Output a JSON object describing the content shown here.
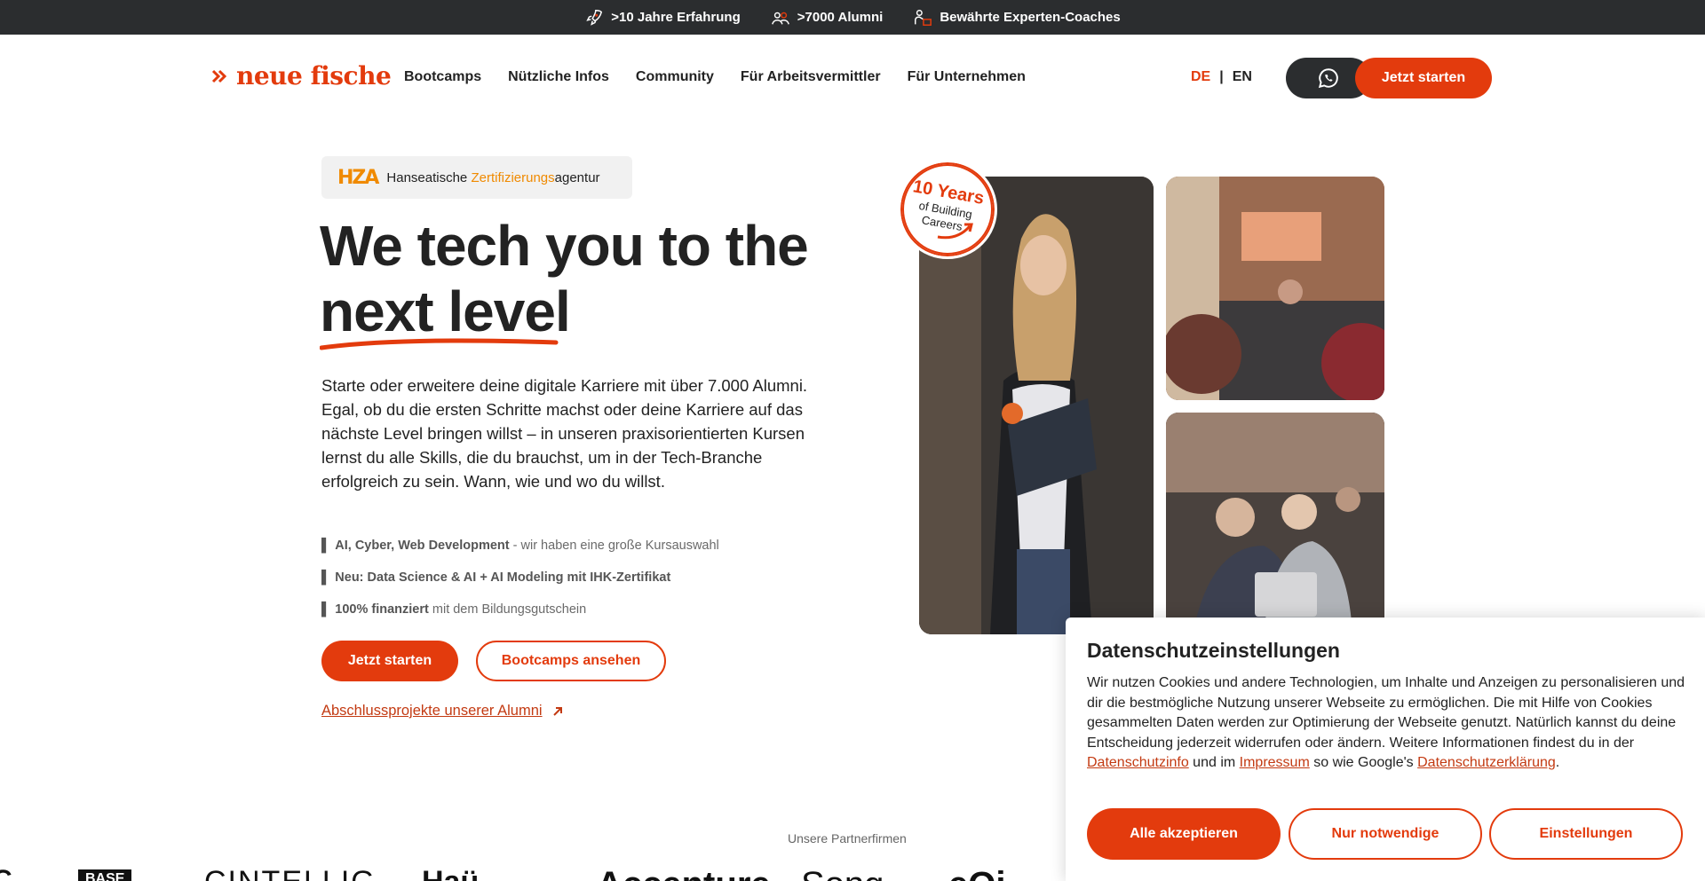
{
  "topbar": {
    "items": [
      {
        "label": ">10 Jahre Erfahrung",
        "icon": "rocket-icon"
      },
      {
        "label": ">7000 Alumni",
        "icon": "people-icon"
      },
      {
        "label": "Bewährte Experten-Coaches",
        "icon": "coach-icon"
      }
    ]
  },
  "nav": {
    "logo_text": "neue fische",
    "links": [
      "Bootcamps",
      "Nützliche Infos",
      "Community",
      "Für Arbeitsvermittler",
      "Für Unternehmen"
    ],
    "lang_active": "DE",
    "lang_separator": "|",
    "lang_other": "EN",
    "whatsapp_icon": "whatsapp-icon",
    "cta_label": "Jetzt starten"
  },
  "badge": {
    "logo_text": "HZA",
    "text_prefix": "Hanseatische ",
    "text_highlight": "Zertifizierungs",
    "text_suffix": "agentur"
  },
  "hero": {
    "title_line1": "We tech you to the",
    "title_line2": "next level",
    "text": "Starte oder erweitere deine digitale Karriere mit über 7.000 Alumni. Egal, ob du die ersten Schritte machst oder deine Karriere auf das nächste Level bringen willst – in unseren praxisorientierten Kursen lernst du alle Skills, die du brauchst, um in der Tech-Branche erfolgreich zu sein. Wann, wie und wo du willst.",
    "bullets": [
      {
        "mark": "▌",
        "bold": "AI, Cyber, Web Development",
        "rest": " - wir haben eine große Kursauswahl"
      },
      {
        "mark": "▌",
        "bold": "Neu: Data Science & AI + AI Modeling mit IHK-Zertifikat",
        "rest": ""
      },
      {
        "mark": "▌",
        "bold": "100% finanziert",
        "rest": " mit dem Bildungsgutschein"
      }
    ],
    "primary_button": "Jetzt starten",
    "secondary_button": "Bootcamps ansehen",
    "alumni_link": "Abschlussprojekte unserer Alumni",
    "alumni_link_icon": "arrow-up-right-icon"
  },
  "stamp": {
    "line1": "10 Years",
    "line2": "of Building",
    "line3": "Careers"
  },
  "partners": {
    "label": "Unsere Partnerfirmen",
    "names": [
      "C",
      "BASE",
      "CINTELLIG",
      "Haü",
      "Accenture",
      "Song",
      "eQi"
    ]
  },
  "cookie": {
    "title": "Datenschutzeinstellungen",
    "text_part1": "Wir nutzen Cookies und andere Technologien, um Inhalte und Anzeigen zu personalisieren und dir die bestmögliche Nutzung unserer Webseite zu ermöglichen. Die mit Hilfe von Cookies gesammelten Daten werden zur Optimierung der Webseite genutzt. Natürlich kannst du deine Entscheidung jederzeit widerrufen oder ändern. Weitere Informationen findest du in der ",
    "link1": "Datenschutzinfo",
    "text_part2": " und im ",
    "link2": "Impressum",
    "text_part3": " so wie Google's ",
    "link3": "Datenschutzerklärung",
    "text_part4": ".",
    "accept": "Alle akzeptieren",
    "necessary": "Nur notwendige",
    "settings": "Einstellungen"
  },
  "colors": {
    "brand": "#e33b0d",
    "dark": "#2b2d2f",
    "hza_orange": "#f08a00"
  }
}
